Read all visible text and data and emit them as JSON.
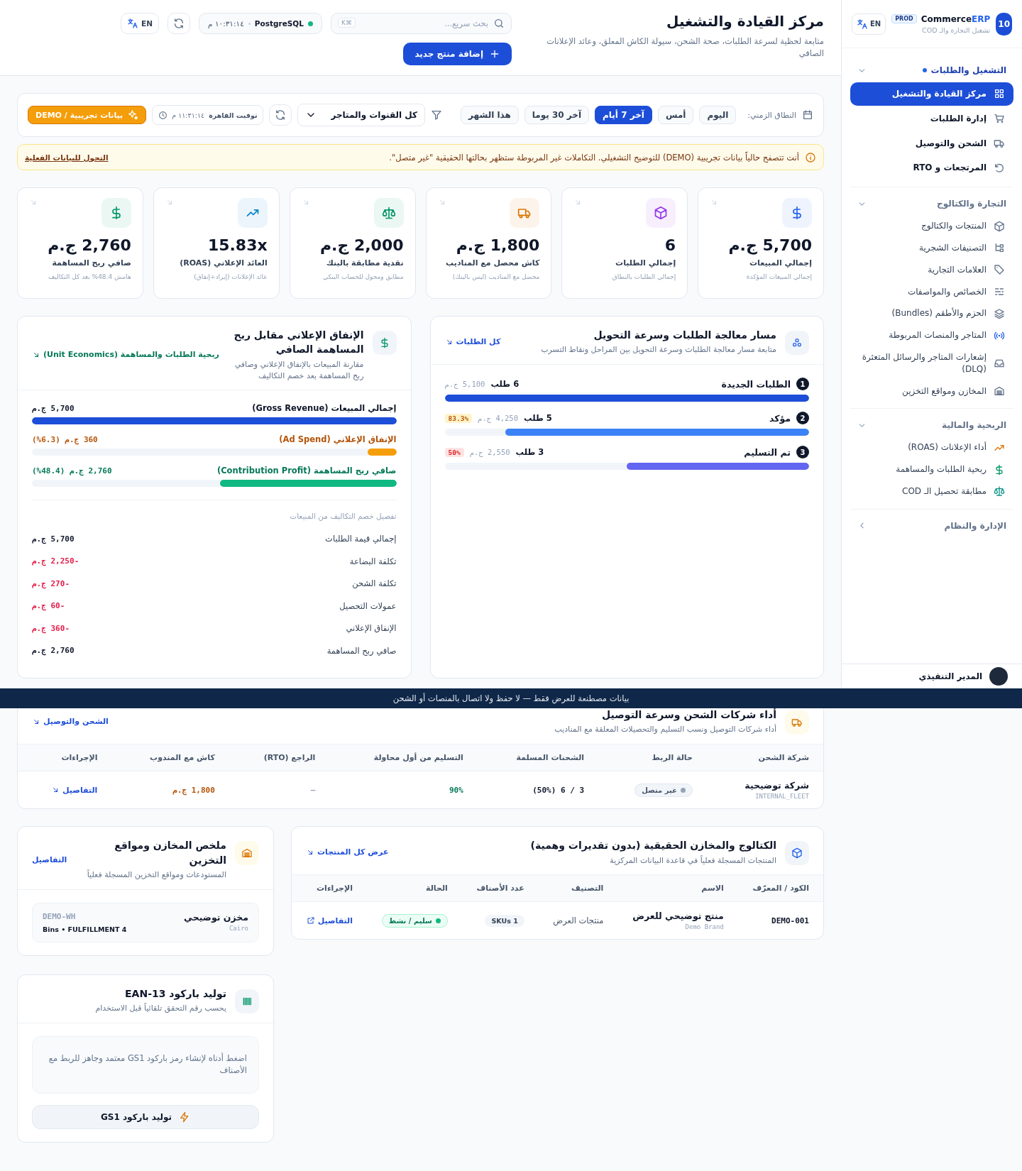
{
  "sidebar": {
    "logo": "10",
    "brand": "Commerce",
    "brand_accent": "ERP",
    "env_badge": "PROD",
    "tagline": "تشغيل التجارة والـ COD",
    "language": "EN",
    "groups": [
      {
        "title": "التشغيل والطلبات",
        "active": true,
        "expanded": true,
        "items": [
          {
            "label": "مركز القيادة والتشغيل",
            "selected": true
          },
          {
            "label": "إدارة الطلبات",
            "selected": false
          },
          {
            "label": "الشحن والتوصيل",
            "selected": false
          },
          {
            "label": "المرتجعات و RTO",
            "selected": false
          }
        ]
      },
      {
        "title": "التجارة والكتالوج",
        "active": false,
        "expanded": true,
        "items": [
          {
            "label": "المنتجات والكتالوج",
            "selected": false
          },
          {
            "label": "التصنيفات الشجرية",
            "selected": false
          },
          {
            "label": "العلامات التجارية",
            "selected": false
          },
          {
            "label": "الخصائص والمواصفات",
            "selected": false
          },
          {
            "label": "الحزم والأطقم (Bundles)",
            "selected": false
          },
          {
            "label": "المتاجر والمنصات المربوطة",
            "selected": false
          },
          {
            "label": "إشعارات المتاجر والرسائل المتعثرة (DLQ)",
            "selected": false
          },
          {
            "label": "المخازن ومواقع التخزين",
            "selected": false
          }
        ]
      },
      {
        "title": "الربحية والمالية",
        "active": false,
        "expanded": true,
        "items": [
          {
            "label": "أداء الإعلانات (ROAS)",
            "selected": false
          },
          {
            "label": "ربحية الطلبات والمساهمة",
            "selected": false
          },
          {
            "label": "مطابقة تحصيل الـ COD",
            "selected": false
          }
        ]
      },
      {
        "title": "الإدارة والنظام",
        "active": false,
        "expanded": false
      }
    ],
    "footer": {
      "user": "المدير التنفيذي"
    }
  },
  "header": {
    "title": "مركز القيادة والتشغيل",
    "subtitle": "متابعة لحظية لسرعة الطلبات، صحة الشحن، سيولة الكاش المعلق، وعائد الإعلانات الصافي",
    "search": {
      "placeholder": "بحث سريع...",
      "shortcut": "⌘K"
    },
    "db_status": {
      "name": "PostgreSQL",
      "online": true,
      "time": "١٠:٣١:١٤ م"
    },
    "language": "EN",
    "add_button": "إضافة منتج جديد"
  },
  "filters": {
    "range_label": "النطاق الزمني:",
    "ranges": [
      {
        "label": "اليوم",
        "selected": false
      },
      {
        "label": "أمس",
        "selected": false
      },
      {
        "label": "آخر 7 أيام",
        "selected": true
      },
      {
        "label": "آخر 30 يوما",
        "selected": false
      },
      {
        "label": "هذا الشهر",
        "selected": false
      }
    ],
    "channel_select": "كل القنوات والمتاجر",
    "time": "١١:٣١:١٤ م",
    "timezone": "توقيت القاهرة",
    "demo_button": "بيانات تجريبية / DEMO"
  },
  "alert": {
    "text": "أنت تتصفح حالياً بيانات تجريبية (DEMO) للتوضيح التشغيلي. التكاملات غير المربوطة ستظهر بحالتها الحقيقية \"غير متصل\".",
    "link": "التحول للبيانات الفعلية"
  },
  "kpis": [
    {
      "value": "5,700 ج.م",
      "label": "إجمالي المبيعات",
      "note": "إجمالي المبيعات المؤكدة",
      "color": "#2563eb"
    },
    {
      "value": "6",
      "label": "إجمالي الطلبات",
      "note": "إجمالي الطلبات بالنطاق",
      "color": "#9333ea"
    },
    {
      "value": "1,800 ج.م",
      "label": "كاش محصل مع المناديب",
      "note": "محصل مع المناديب (ليس بالبنك)",
      "color": "#d97706"
    },
    {
      "value": "2,000 ج.م",
      "label": "نقدية مطابقة بالبنك",
      "note": "مطابق ومحول للحساب البنكي",
      "color": "#059669"
    },
    {
      "value": "15.83x",
      "label": "العائد الإعلاني (ROAS)",
      "note": "عائد الإعلانات (إيراد÷إنفاق)",
      "color": "#0284c7"
    },
    {
      "value": "2,760 ج.م",
      "label": "صافي ربح المساهمة",
      "note": "هامش 48.4% بعد كل التكاليف",
      "color": "#059669"
    }
  ],
  "funnel": {
    "title": "مسار معالجة الطلبات وسرعة التحويل",
    "subtitle": "متابعة مسار معالجة الطلبات وسرعة التحويل بين المراحل ونقاط التسرب",
    "link": "كل الطلبات",
    "stages": [
      {
        "number": "1",
        "name": "الطلبات الجديدة",
        "count": "6 طلب",
        "amount": "5,100 ج.م",
        "level": 1,
        "color": "#1d4ed8"
      },
      {
        "number": "2",
        "name": "مؤكد",
        "count": "5 طلب",
        "amount": "4,250 ج.م",
        "badge": "83.3%",
        "kind": "warning",
        "level": 0.833,
        "color": "#3b82f6"
      },
      {
        "number": "3",
        "name": "تم التسليم",
        "count": "3 طلب",
        "amount": "2,550 ج.م",
        "badge": "50%",
        "kind": "danger",
        "level": 0.5,
        "color": "#6366f1"
      }
    ]
  },
  "ad_panel": {
    "title": "الإنفاق الإعلاني مقابل ربح المساهمة الصافي",
    "subtitle": "مقارنة المبيعات بالإنفاق الإعلاني وصافي ربح المساهمة بعد خصم التكاليف",
    "link": "ربحية الطلبات والمساهمة (Unit Economics)",
    "metrics": [
      {
        "label": "إجمالي المبيعات (Gross Revenue)",
        "value": "5,700 ج.م",
        "level": 1,
        "color": "#1d4ed8"
      },
      {
        "label": "الإنفاق الإعلاني (Ad Spend)",
        "value": "360 ج.م (6.3%)",
        "level": 0.078,
        "color": "#f59e0b"
      },
      {
        "label": "صافي ربح المساهمة (Contribution Profit)",
        "value": "2,760 ج.م (48.4%)",
        "level": 0.484,
        "color": "#10b981"
      }
    ],
    "breakdown_title": "تفصيل خصم التكاليف من المبيعات",
    "breakdown": [
      {
        "label": "إجمالي قيمة الطلبات",
        "value": "5,700 ج.م",
        "negative": false
      },
      {
        "label": "تكلفة البضاعة",
        "value": "-2,250 ج.م",
        "negative": true
      },
      {
        "label": "تكلفة الشحن",
        "value": "-270 ج.م",
        "negative": true
      },
      {
        "label": "عمولات التحصيل",
        "value": "-60 ج.م",
        "negative": true
      },
      {
        "label": "الإنفاق الإعلاني",
        "value": "-360 ج.م",
        "negative": true
      },
      {
        "label": "صافي ربح المساهمة",
        "value": "2,760 ج.م",
        "negative": false
      }
    ]
  },
  "banner": {
    "text": "بيانات مصطنعة للعرض فقط — لا حفظ ولا اتصال بالمنصات أو الشحن"
  },
  "carriers": {
    "title": "أداء شركات الشحن وسرعة التوصيل",
    "subtitle": "أداء شركات التوصيل ونسب التسليم والتحصيلات المعلقة مع المناديب",
    "link": "الشحن والتوصيل",
    "columns": [
      "شركة الشحن",
      "حالة الربط",
      "الشحنات المسلمة",
      "التسليم من أول محاولة",
      "الراجع (RTO)",
      "كاش مع المندوب",
      "الإجراءات"
    ],
    "rows": [
      {
        "name": "شركة توضيحية",
        "code": "INTERNAL_FLEET",
        "connected": false,
        "status": "غير متصل",
        "delivered": "3 / 6 (50%)",
        "first_attempt": "90%",
        "rto": "—",
        "cash": "1,800 ج.م",
        "action": "التفاصيل"
      }
    ]
  },
  "catalog": {
    "title": "الكتالوج والمخازن الحقيقية (بدون تقديرات وهمية)",
    "subtitle": "المنتجات المسجلة فعلياً في قاعدة البيانات المركزية",
    "link": "عرض كل المنتجات",
    "columns": [
      "الكود / المعرّف",
      "الاسم",
      "التصنيف",
      "عدد الأصناف",
      "الحالة",
      "الإجراءات"
    ],
    "rows": [
      {
        "code": "DEMO-001",
        "name": "منتج توضيحي للعرض",
        "brand": "Demo Brand",
        "category": "منتجات العرض",
        "skus": "1 SKUs",
        "active": true,
        "status": "سليم / نشط",
        "action": "التفاصيل"
      }
    ]
  },
  "warehouses": {
    "title": "ملخص المخازن ومواقع التخزين",
    "subtitle": "المستودعات ومواقع التخزين المسجلة فعلياً",
    "link": "التفاصيل",
    "items": [
      {
        "name": "مخزن توضيحي",
        "city": "Cairo",
        "code": "DEMO-WH",
        "meta": "Bins • FULFILLMENT 4"
      }
    ]
  },
  "barcode": {
    "title": "توليد باركود EAN-13",
    "subtitle": "يحسب رقم التحقق تلقائياً قبل الاستخدام",
    "hint": "اضغط أدناه لإنشاء رمز باركود GS1 معتمد وجاهز للربط مع الأصناف",
    "button": "توليد باركود GS1"
  }
}
